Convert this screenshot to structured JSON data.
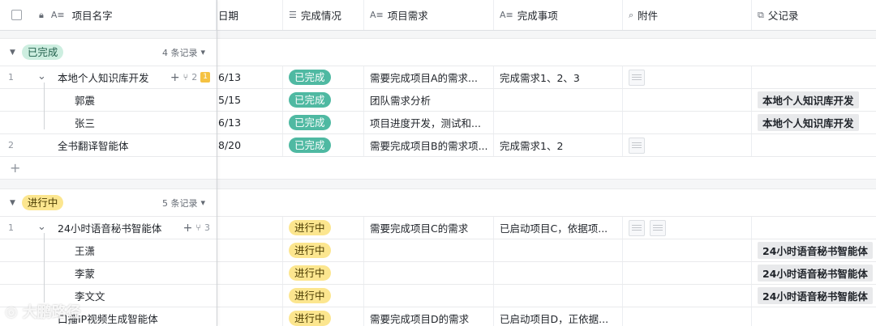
{
  "header": {
    "columns": [
      {
        "key": "name",
        "label": "项目名字",
        "icon": "text-icon"
      },
      {
        "key": "date",
        "label": "日期",
        "icon": ""
      },
      {
        "key": "status",
        "label": "完成情况",
        "icon": "list-icon"
      },
      {
        "key": "req",
        "label": "项目需求",
        "icon": "text-icon"
      },
      {
        "key": "items",
        "label": "完成事项",
        "icon": "text-icon"
      },
      {
        "key": "attach",
        "label": "附件",
        "icon": "paperclip-icon"
      },
      {
        "key": "parent",
        "label": "父记录",
        "icon": "link-icon"
      }
    ]
  },
  "groups": [
    {
      "label": "已完成",
      "count": "4 条记录",
      "rows": [
        {
          "num": "1",
          "name": "本地个人知识库开发",
          "date": "6/13",
          "status": "已完成",
          "req": "需要完成项目A的需求...",
          "items": "完成需求1、2、3",
          "attach": 1,
          "parent": "",
          "expand": true,
          "children": "2",
          "badge": "1",
          "level": 0
        },
        {
          "num": "",
          "name": "郭震",
          "date": "5/15",
          "status": "已完成",
          "req": "团队需求分析",
          "items": "",
          "attach": 0,
          "parent": "本地个人知识库开发",
          "level": 1
        },
        {
          "num": "",
          "name": "张三",
          "date": "6/13",
          "status": "已完成",
          "req": "项目进度开发，测试和...",
          "items": "",
          "attach": 0,
          "parent": "本地个人知识库开发",
          "level": 1
        },
        {
          "num": "2",
          "name": "全书翻译智能体",
          "date": "8/20",
          "status": "已完成",
          "req": "需要完成项目B的需求项...",
          "items": "完成需求1、2",
          "attach": 1,
          "parent": "",
          "level": 0
        }
      ]
    },
    {
      "label": "进行中",
      "count": "5 条记录",
      "rows": [
        {
          "num": "1",
          "name": "24小时语音秘书智能体",
          "date": "",
          "status": "进行中",
          "req": "需要完成项目C的需求",
          "items": "已启动项目C，依据项...",
          "attach": 2,
          "parent": "",
          "expand": true,
          "children": "3",
          "level": 0
        },
        {
          "num": "",
          "name": "王潇",
          "date": "",
          "status": "进行中",
          "req": "",
          "items": "",
          "attach": 0,
          "parent": "24小时语音秘书智能体",
          "level": 1
        },
        {
          "num": "",
          "name": "李蒙",
          "date": "",
          "status": "进行中",
          "req": "",
          "items": "",
          "attach": 0,
          "parent": "24小时语音秘书智能体",
          "level": 1
        },
        {
          "num": "",
          "name": "李文文",
          "date": "",
          "status": "进行中",
          "req": "",
          "items": "",
          "attach": 0,
          "parent": "24小时语音秘书智能体",
          "level": 1
        },
        {
          "num": "",
          "name": "口播IP视频生成智能体",
          "date": "",
          "status": "进行中",
          "req": "需要完成项目D的需求",
          "items": "已启动项目D，正依据...",
          "attach": 0,
          "parent": "",
          "level": 0
        }
      ]
    }
  ],
  "watermark": "大鹏路径",
  "colors": {
    "done": "#4fb9a2",
    "done_group": "#cdeee0",
    "progress": "#fce68f"
  }
}
